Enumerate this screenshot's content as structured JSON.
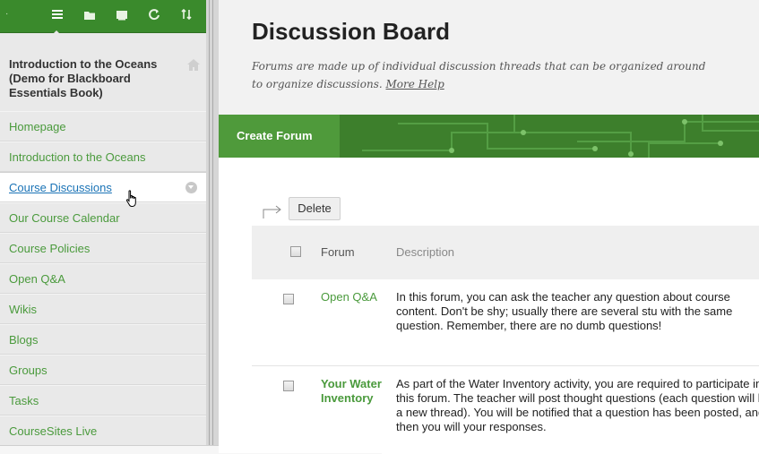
{
  "sidebar": {
    "course_title": "Introduction to the Oceans (Demo for Blackboard Essentials Book)",
    "toolbar_icons": [
      "menu-icon",
      "folder-icon",
      "window-icon",
      "refresh-icon",
      "sort-icon"
    ],
    "items": [
      {
        "label": "Homepage"
      },
      {
        "label": "Introduction to the Oceans"
      },
      {
        "label": "Course Discussions"
      },
      {
        "label": "Our Course Calendar"
      },
      {
        "label": "Course Policies"
      },
      {
        "label": "Open Q&A"
      },
      {
        "label": "Wikis"
      },
      {
        "label": "Blogs"
      },
      {
        "label": "Groups"
      },
      {
        "label": "Tasks"
      },
      {
        "label": "CourseSites Live"
      }
    ]
  },
  "main": {
    "title": "Discussion Board",
    "description": "Forums are made up of individual discussion threads that can be organized around",
    "description_line2": "to organize discussions.",
    "help_link": "More Help",
    "create_forum": "Create Forum",
    "delete": "Delete",
    "table": {
      "col_forum": "Forum",
      "col_description": "Description",
      "rows": [
        {
          "forum": "Open Q&A",
          "description": "In this forum, you can ask the teacher any question about course content. Don't be shy; usually there are several stu with the same question. Remember, there are no dumb questions!"
        },
        {
          "forum": "Your Water Inventory",
          "description": "As part of the Water Inventory activity, you are required to participate in this forum. The teacher will post thought questions (each question will be a new thread). You will be notified that a question has been posted, and then you will your responses."
        }
      ]
    }
  },
  "colors": {
    "brand_green": "#3a8a2c",
    "link_green": "#4a9a3c",
    "active_link": "#1a73b6"
  }
}
